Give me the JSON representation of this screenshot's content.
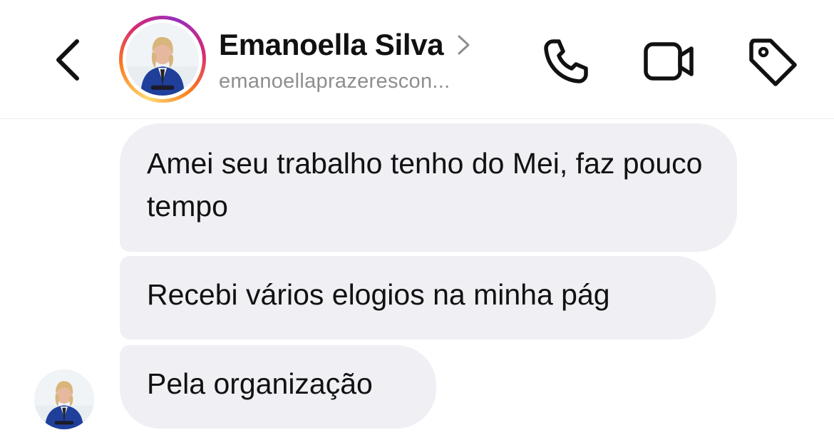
{
  "header": {
    "contact_name": "Emanoella Silva",
    "username": "emanoellaprazerescon...",
    "icons": {
      "back": "chevron-left-icon",
      "profile_chevron": "chevron-right-icon",
      "call": "phone-icon",
      "video": "video-camera-icon",
      "label": "tag-icon"
    },
    "story_ring_colors": [
      "#feda75",
      "#fa7e1e",
      "#d62976",
      "#962fbf"
    ]
  },
  "messages": [
    {
      "text": "Amei seu trabalho tenho do Mei, faz pouco tempo"
    },
    {
      "text": "Recebi vários elogios na minha pág"
    },
    {
      "text": "Pela organização"
    }
  ],
  "colors": {
    "bubble": "#efeff4",
    "text": "#111111",
    "secondary_text": "#8e8e8e"
  }
}
